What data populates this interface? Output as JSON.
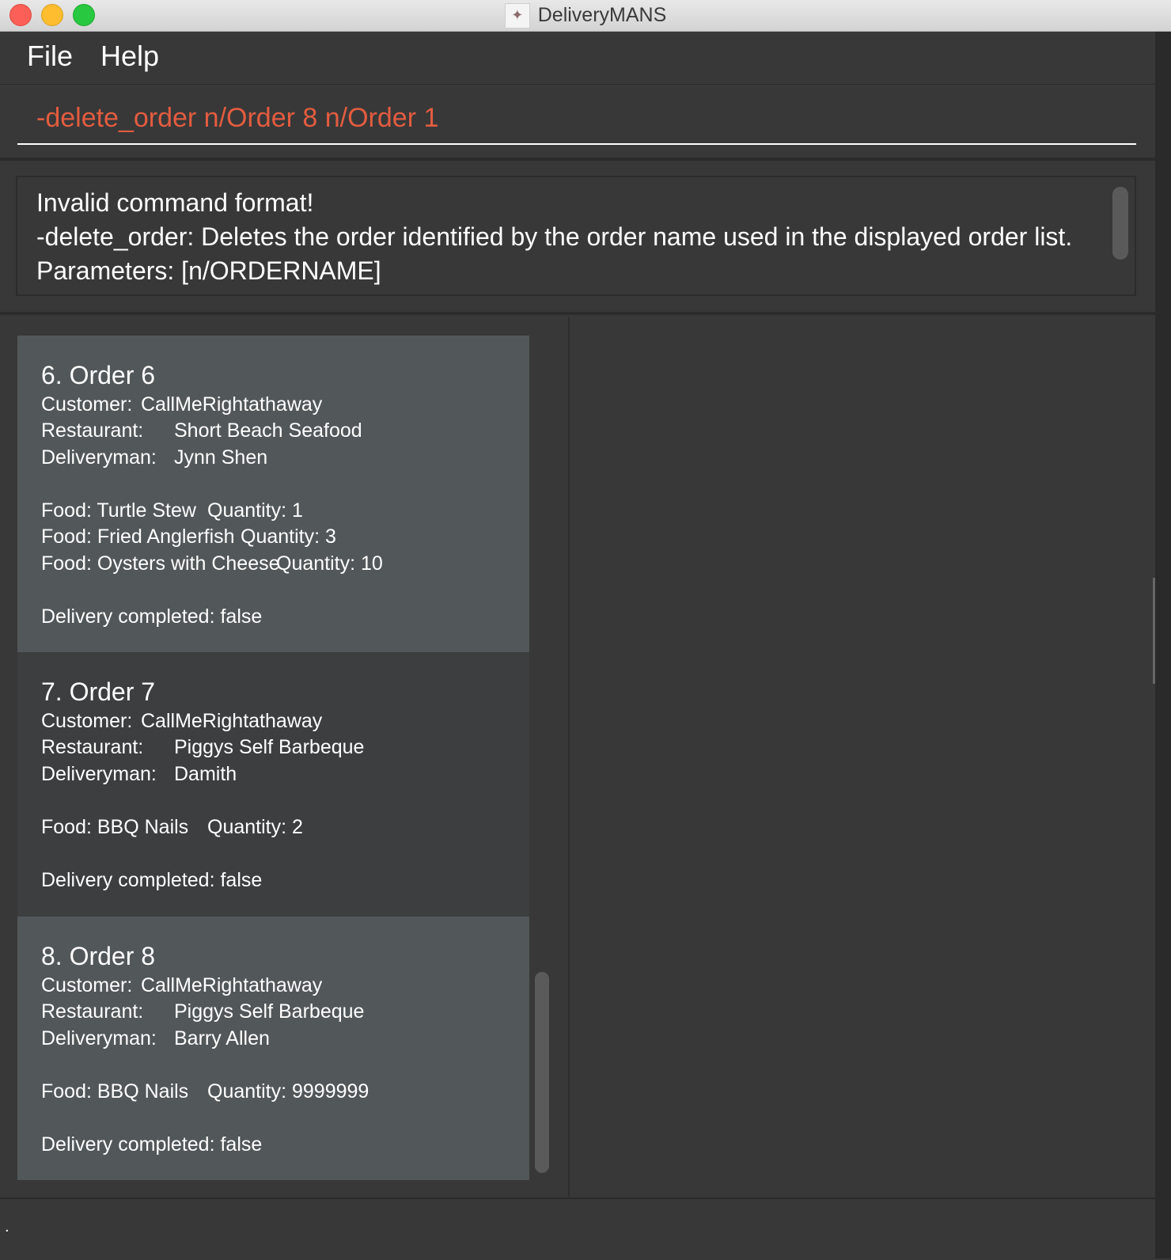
{
  "window": {
    "title": "DeliveryMANS",
    "app_icon": "app-logo-icon"
  },
  "menu": {
    "file": "File",
    "help": "Help"
  },
  "command": {
    "value": "-delete_order n/Order 8 n/Order 1",
    "text_color": "#e35c40"
  },
  "result": {
    "line1": "Invalid command format!",
    "line2": "-delete_order: Deletes the order identified by the order name used in the displayed order list.",
    "line3": "Parameters: [n/ORDERNAME]"
  },
  "labels": {
    "customer": "Customer:",
    "restaurant": "Restaurant:",
    "deliveryman": "Deliveryman:"
  },
  "orders": [
    {
      "title": "6.  Order 6",
      "customer": "CallMeRightathaway",
      "restaurant": "Short Beach Seafood",
      "deliveryman": "Jynn Shen",
      "foods": [
        {
          "food": "Food: Turtle Stew",
          "quantity": "Quantity: 1"
        },
        {
          "food": "Food: Fried Anglerfish",
          "quantity": "Quantity: 3"
        },
        {
          "food": "Food: Oysters with Cheese",
          "quantity": "Quantity: 10"
        }
      ],
      "delivery": "Delivery completed: false"
    },
    {
      "title": "7.  Order 7",
      "customer": "CallMeRightathaway",
      "restaurant": "Piggys Self Barbeque",
      "deliveryman": "Damith",
      "foods": [
        {
          "food": "Food: BBQ Nails",
          "quantity": "Quantity: 2"
        }
      ],
      "delivery": "Delivery completed: false"
    },
    {
      "title": "8.  Order 8",
      "customer": "CallMeRightathaway",
      "restaurant": "Piggys Self Barbeque",
      "deliveryman": "Barry Allen",
      "foods": [
        {
          "food": "Food: BBQ Nails",
          "quantity": "Quantity: 9999999"
        }
      ],
      "delivery": "Delivery completed: false"
    }
  ],
  "status": {
    "text": "."
  }
}
